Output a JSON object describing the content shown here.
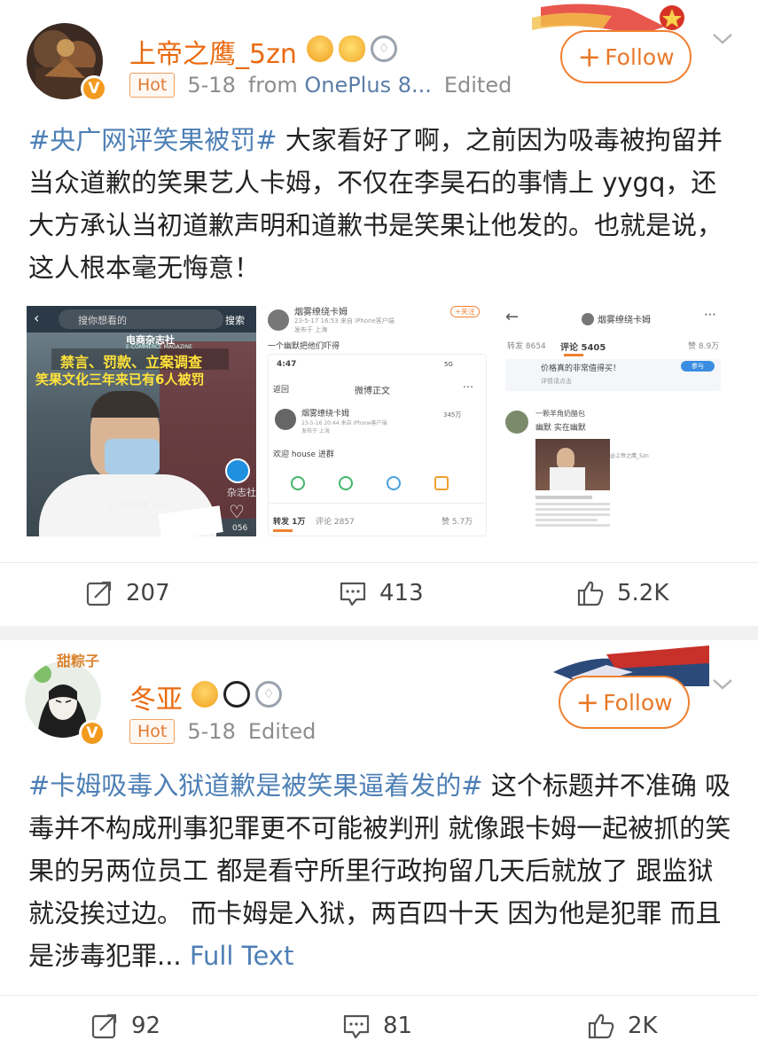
{
  "posts": [
    {
      "username": "上帝之鹰_5zn",
      "hot": "Hot",
      "date": "5-18",
      "source_prefix": "from",
      "source_device": "OnePlus 8...",
      "edited": "Edited",
      "follow_label": "Follow",
      "hashtag": "#央广网评笑果被罚#",
      "body": " 大家看好了啊，之前因为吸毒被拘留并当众道歉的笑果艺人卡姆，不仅在李昊石的事情上 yygq，还大方承认当初道歉声明和道歉书是笑果让他发的。也就是说，这人根本毫无悔意！",
      "reposts": "207",
      "comments": "413",
      "likes": "5.2K",
      "images": {
        "img1": {
          "search_placeholder": "搜你想看的",
          "search_btn": "搜索",
          "magazine": "电商杂志社",
          "magazine_en": "E-COMMERCE MAGAZINE",
          "headline1": "禁言、罚款、立案调查",
          "headline2": "笑果文化三年来已有6人被罚",
          "watermark": "@上帝之鹰_5zn",
          "corner": "杂志社",
          "count": "056"
        },
        "img2": {
          "top_name": "烟雾缭绕卡姆",
          "top_meta": "23-5-17 16:53 来自 iPhone客户端",
          "top_loc": "发布于 上海",
          "top_follow": "+关注",
          "quote": "一个幽默把他们吓得",
          "time": "4:47",
          "signal": "5G",
          "back": "返回",
          "page_title": "微博正文",
          "name": "烟雾缭绕卡姆",
          "meta": "23-5-16 20:44 来自 iPhone客户端",
          "loc": "发布于 上海",
          "fans": "345万",
          "post_text": "欢迎 house 进群",
          "tab_repost": "转发 1万",
          "tab_comment": "评论 2857",
          "tab_like": "赞 5.7万"
        },
        "img3": {
          "title": "烟雾缭绕卡姆",
          "tab_repost": "转发 8654",
          "tab_comment": "评论 5405",
          "tab_like": "赞 8.9万",
          "ad_text": "价格真的非常值得买！",
          "ad_sub": "详情请点击",
          "ad_btn": "参与",
          "commenter": "一颗羊角奶酪包",
          "comment": "幽默 实在幽默",
          "watermark": "@上帝之鹰_5zn"
        }
      }
    },
    {
      "username": "冬亚",
      "hot": "Hot",
      "date": "5-18",
      "edited": "Edited",
      "follow_label": "Follow",
      "hashtag": "#卡姆吸毒入狱道歉是被笑果逼着发的#",
      "body": " 这个标题并不准确 吸毒并不构成刑事犯罪更不可能被判刑 就像跟卡姆一起被抓的笑果的另两位员工 都是看守所里行政拘留几天后就放了 跟监狱就没挨过边。 而卡姆是入狱，两百四十天 因为他是犯罪 而且是涉毒犯罪...",
      "full_text": " Full Text",
      "avatar_text": "甜粽子",
      "reposts": "92",
      "comments": "81",
      "likes": "2K"
    }
  ],
  "colors": {
    "accent": "#ea6a10",
    "link": "#4d7fb5",
    "hot": "#e07b33"
  }
}
